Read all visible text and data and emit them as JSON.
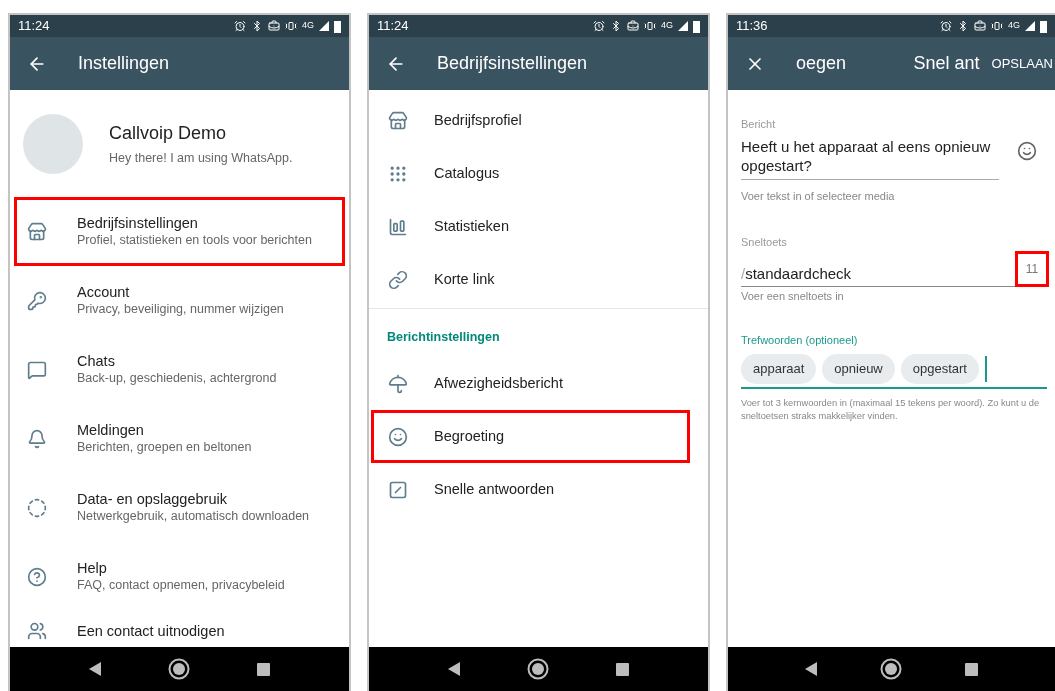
{
  "screens": [
    {
      "kind": "settings",
      "status": {
        "time": "11:24",
        "network": "4G"
      },
      "toolbar": {
        "title": "Instellingen"
      },
      "profile": {
        "name": "Callvoip Demo",
        "about": "Hey there! I am using WhatsApp."
      },
      "items": [
        {
          "kind": "item",
          "title": "Bedrijfsinstellingen",
          "subtitle": "Profiel, statistieken en tools voor berichten",
          "highlighted": true
        },
        {
          "kind": "item",
          "title": "Account",
          "subtitle": "Privacy, beveiliging, nummer wijzigen",
          "highlighted": false
        },
        {
          "kind": "item",
          "title": "Chats",
          "subtitle": "Back-up, geschiedenis, achtergrond",
          "highlighted": false
        },
        {
          "kind": "item",
          "title": "Meldingen",
          "subtitle": "Berichten, groepen en beltonen",
          "highlighted": false
        },
        {
          "kind": "item",
          "title": "Data- en opslaggebruik",
          "subtitle": "Netwerkgebruik, automatisch downloaden",
          "highlighted": false
        },
        {
          "kind": "item",
          "title": "Help",
          "subtitle": "FAQ, contact opnemen, privacybeleid",
          "highlighted": false
        },
        {
          "kind": "divider"
        },
        {
          "kind": "item",
          "title": "Een contact uitnodigen",
          "highlighted": false
        }
      ]
    },
    {
      "kind": "list",
      "status": {
        "time": "11:24",
        "network": "4G"
      },
      "toolbar": {
        "title": "Bedrijfsinstellingen"
      },
      "items": [
        {
          "kind": "item",
          "title": "Bedrijfsprofiel",
          "highlighted": false
        },
        {
          "kind": "item",
          "title": "Catalogus",
          "highlighted": false
        },
        {
          "kind": "item",
          "title": "Statistieken",
          "highlighted": false
        },
        {
          "kind": "item",
          "title": "Korte link",
          "highlighted": false
        },
        {
          "kind": "divider"
        },
        {
          "kind": "header",
          "title": "Berichtinstellingen"
        },
        {
          "kind": "item",
          "title": "Afwezigheidsbericht",
          "highlighted": false
        },
        {
          "kind": "item",
          "title": "Begroeting",
          "highlighted": true
        },
        {
          "kind": "item",
          "title": "Snelle antwoorden",
          "highlighted": false
        }
      ]
    },
    {
      "kind": "form",
      "status": {
        "time": "11:36",
        "network": "4G"
      },
      "toolbar": {
        "title": "oegen",
        "title_2": "Snel ant",
        "action": "OPSLAAN"
      },
      "message": {
        "label": "Bericht",
        "value": "Heeft u het apparaat al eens opnieuw opgestart?",
        "helper": "Voer tekst in of selecteer media"
      },
      "shortcut": {
        "label": "Sneltoets",
        "prefix": "/",
        "value": "standaardcheck",
        "counter": "11",
        "counter_highlighted": true,
        "helper": "Voer een sneltoets in"
      },
      "keywords": {
        "label": "Trefwoorden (optioneel)",
        "chips": [
          "apparaat",
          "opnieuw",
          "opgestart"
        ],
        "helper": "Voer tot 3 kernwoorden in (maximaal 15 tekens per woord). Zo kunt u de sneltoetsen straks makkelijker vinden."
      }
    }
  ]
}
